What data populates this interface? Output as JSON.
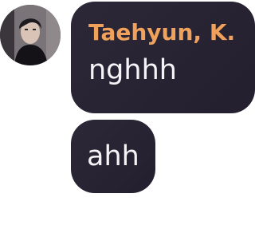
{
  "colors": {
    "bubble_bg": "#2a2635",
    "message_text": "#f4f3f6",
    "sender_name": "#f0a15c"
  },
  "messages": [
    {
      "sender": "Taehyun, K.",
      "text": "nghhh"
    },
    {
      "text": "ahh"
    }
  ]
}
